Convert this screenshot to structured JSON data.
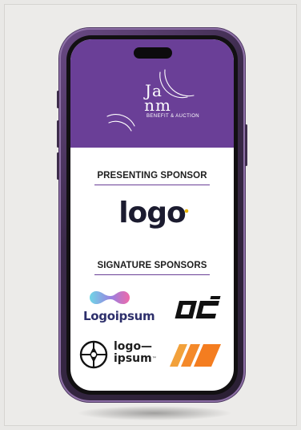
{
  "header": {
    "brand_line1": "Ja",
    "brand_line2": "nm",
    "brand_subtitle": "BENEFIT & AUCTION",
    "background_color": "#6a3f97"
  },
  "presenting": {
    "heading": "PRESENTING SPONSOR",
    "logo_text": "logo"
  },
  "signature": {
    "heading": "SIGNATURE SPONSORS",
    "sponsors": [
      {
        "name": "Logoipsum",
        "icon": "gradient-blob-icon"
      },
      {
        "name": "",
        "icon": "oc-monogram-icon"
      },
      {
        "name_line1": "logo—",
        "name_line2": "ipsum",
        "mark": "™",
        "icon": "globe-icon"
      },
      {
        "name": "",
        "icon": "stripes-icon"
      }
    ]
  },
  "colors": {
    "accent": "#6a3f97",
    "phone_frame": "#3b2a4a",
    "logoipsum_text": "#2d2f6b",
    "stripes": "#f47d20"
  }
}
